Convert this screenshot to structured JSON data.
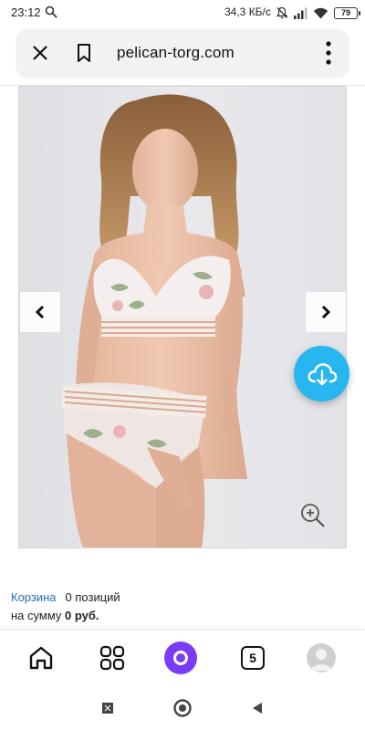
{
  "status_bar": {
    "time": "23:12",
    "network_speed": "34,3 КБ/с",
    "battery": "79",
    "icons": [
      "search-icon",
      "mute-icon",
      "signal-icon",
      "wifi-icon",
      "battery-icon"
    ]
  },
  "browser": {
    "url": "pelican-torg.com",
    "icons": [
      "close-icon",
      "bookmark-icon",
      "more-vert-icon"
    ]
  },
  "gallery": {
    "icons": [
      "chevron-left-icon",
      "chevron-right-icon",
      "zoom-in-icon",
      "cloud-download-icon"
    ]
  },
  "cart": {
    "link_label": "Корзина",
    "count_text": "0 позиций",
    "sum_prefix": "на сумму",
    "sum_value": "0 руб."
  },
  "bottom_nav": {
    "tabs_count": "5",
    "icons": [
      "home-icon",
      "apps-grid-icon",
      "alice-icon",
      "tabs-icon",
      "profile-avatar"
    ]
  },
  "system_nav": {
    "icons": [
      "recents-icon",
      "home-circle-icon",
      "back-triangle-icon"
    ]
  },
  "colors": {
    "accent": "#27b6f0",
    "link": "#1f6fb2",
    "alice": "#7b3cf6",
    "photo_bg": "#e5e6ea"
  }
}
